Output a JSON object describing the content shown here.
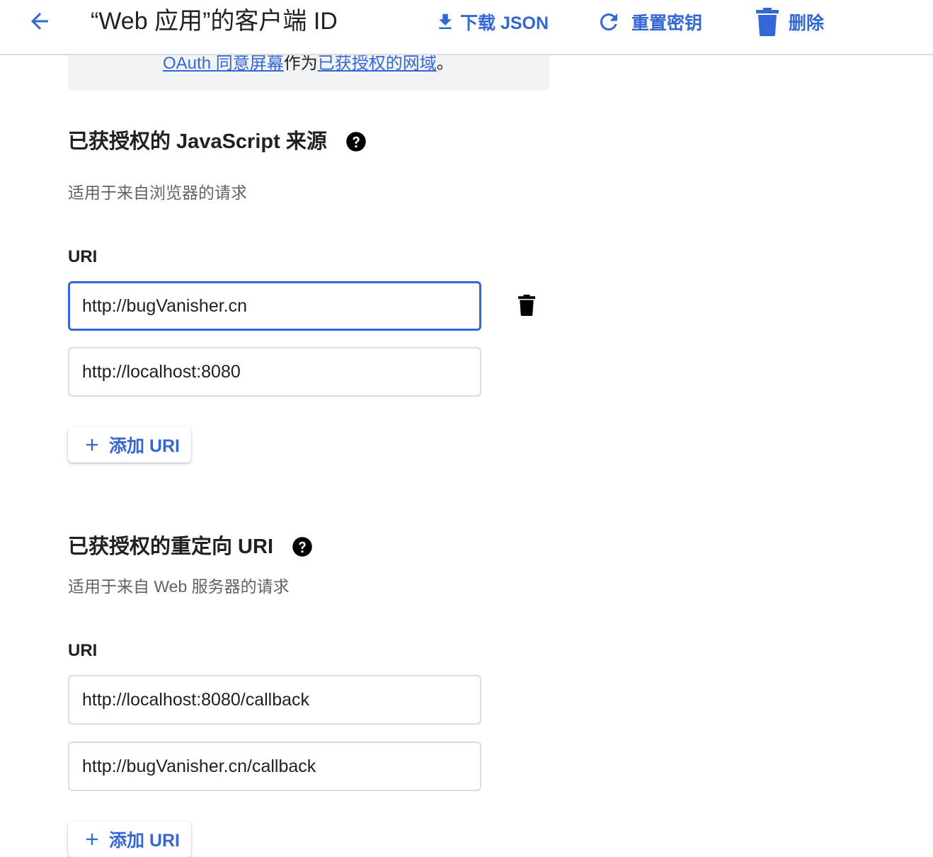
{
  "header": {
    "title": "“Web 应用”的客户端 ID",
    "download_label": "下载 JSON",
    "reset_label": "重置密钥",
    "delete_label": "删除"
  },
  "info": {
    "link_consent": "OAuth 同意屏幕",
    "text_middle": "作为",
    "link_domains": "已获授权的网域",
    "text_end": "。"
  },
  "js_origins": {
    "title": "已获授权的 JavaScript 来源",
    "subtitle": "适用于来自浏览器的请求",
    "field_label": "URI",
    "uris": [
      "http://bugVanisher.cn",
      "http://localhost:8080"
    ],
    "add_label": "添加 URI"
  },
  "redirect_uris": {
    "title": "已获授权的重定向 URI",
    "subtitle": "适用于来自 Web 服务器的请求",
    "field_label": "URI",
    "uris": [
      "http://localhost:8080/callback",
      "http://bugVanisher.cn/callback"
    ],
    "add_label": "添加 URI"
  },
  "colors": {
    "accent": "#3367d6",
    "text": "#202124",
    "muted": "#5f6368",
    "border": "#dadce0",
    "info_bg": "#f1f3f4"
  },
  "icons": {
    "back": "arrow-left-icon",
    "download": "download-icon",
    "reset": "refresh-icon",
    "delete": "trash-icon",
    "help": "help-circle-icon",
    "add": "plus-icon"
  }
}
